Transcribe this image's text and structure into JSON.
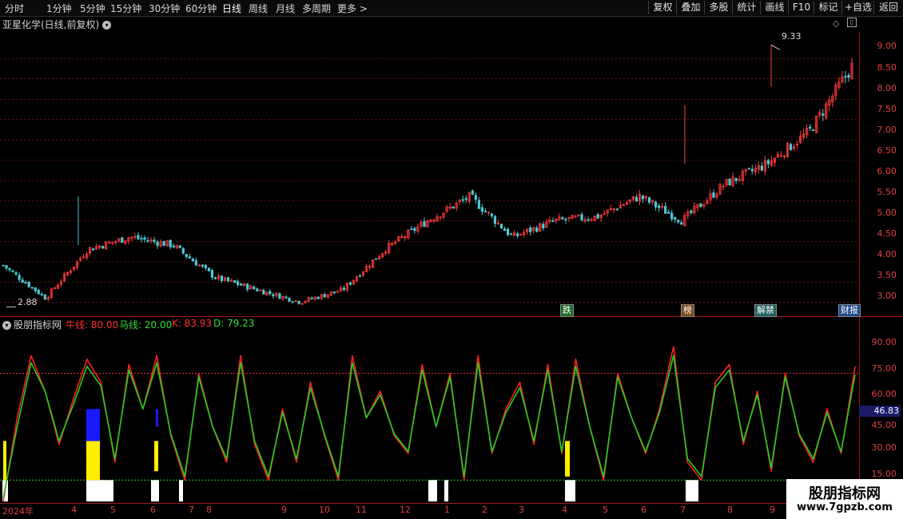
{
  "toolbar": {
    "timeframes": [
      "分时",
      "1分钟",
      "5分钟",
      "15分钟",
      "30分钟",
      "60分钟",
      "日线",
      "周线",
      "月线",
      "多周期",
      "更多 >"
    ],
    "active_timeframe": "日线",
    "buttons": [
      "复权",
      "叠加",
      "多股",
      "统计",
      "画线",
      "F10",
      "标记",
      "+自选",
      "返回"
    ]
  },
  "main_panel": {
    "title": "亚星化学(日线,前复权)",
    "high_label": "9.33",
    "low_label": "2.88",
    "event_markers": [
      {
        "label": "跌",
        "color": "#2e9a3a"
      },
      {
        "label": "榜",
        "color": "#b36a2a"
      },
      {
        "label": "解禁",
        "color": "#2e8a8a"
      },
      {
        "label": "财报",
        "color": "#2a6acc"
      }
    ]
  },
  "indicator_panel": {
    "title": "股朋指标网",
    "labels": [
      {
        "text": "牛线: 80.00",
        "color": "#ff3030"
      },
      {
        "text": "马线: 20.00",
        "color": "#30e030"
      },
      {
        "text": "K: 83.93",
        "color": "#ff3030"
      },
      {
        "text": "D: 79.23",
        "color": "#30e030"
      }
    ],
    "current_value": "46.83"
  },
  "x_axis": {
    "months": [
      "2024年",
      "4",
      "5",
      "6",
      "7",
      "8",
      "9",
      "10",
      "11",
      "12",
      "1",
      "2",
      "3",
      "4",
      "5",
      "6",
      "7",
      "8",
      "9"
    ]
  },
  "watermark": {
    "line1": "股朋指标网",
    "line2": "www.7gpzb.com"
  },
  "chart_data": [
    {
      "type": "candlestick",
      "title": "亚星化学(日线,前复权)",
      "ylim": [
        2.65,
        9.65
      ],
      "yticks": [
        "9.00",
        "8.50",
        "8.00",
        "7.50",
        "7.00",
        "6.50",
        "6.00",
        "5.50",
        "5.00",
        "4.50",
        "4.00",
        "3.50",
        "3.00"
      ],
      "x": [
        "2024-01",
        "2024-02",
        "2024-03",
        "2024-04-mid",
        "2024-05",
        "2024-06",
        "2024-07",
        "2024-08",
        "2024-09",
        "2024-10",
        "2024-11",
        "2024-12",
        "2025-01",
        "2025-02",
        "2025-03",
        "2025-04",
        "2025-05",
        "2025-06",
        "2025-07",
        "2025-08",
        "2025-09"
      ],
      "close": [
        3.9,
        3.1,
        4.3,
        4.6,
        4.4,
        3.6,
        3.3,
        3.0,
        3.3,
        4.3,
        5.0,
        5.6,
        4.6,
        5.0,
        5.1,
        5.6,
        5.0,
        5.9,
        6.4,
        7.2,
        8.8
      ],
      "annotations": {
        "high": 9.33,
        "low": 2.88
      },
      "grid": true
    },
    {
      "type": "line",
      "title": "股朋指标网",
      "ylim": [
        8,
        105
      ],
      "yticks": [
        "90.00",
        "75.00",
        "60.00",
        "45.00",
        "30.00",
        "15.00"
      ],
      "reference_lines": [
        {
          "name": "牛线",
          "value": 80.0
        },
        {
          "name": "马线",
          "value": 20.0
        }
      ],
      "series": [
        {
          "name": "K",
          "color": "#ff2020",
          "values": [
            8,
            55,
            90,
            70,
            40,
            65,
            88,
            75,
            30,
            85,
            60,
            90,
            45,
            20,
            80,
            50,
            30,
            90,
            40,
            20,
            60,
            30,
            75,
            45,
            20,
            90,
            55,
            70,
            45,
            35,
            85,
            50,
            80,
            20,
            90,
            35,
            60,
            75,
            40,
            85,
            35,
            88,
            50,
            20,
            80,
            55,
            35,
            60,
            95,
            30,
            20,
            75,
            85,
            40,
            70,
            25,
            80,
            45,
            30,
            60,
            35,
            83.93
          ]
        },
        {
          "name": "D",
          "color": "#20d020",
          "values": [
            10,
            50,
            86,
            70,
            42,
            62,
            84,
            73,
            32,
            82,
            60,
            86,
            46,
            22,
            78,
            50,
            32,
            86,
            42,
            22,
            58,
            32,
            72,
            46,
            22,
            86,
            55,
            68,
            46,
            36,
            82,
            50,
            78,
            22,
            86,
            36,
            58,
            72,
            42,
            82,
            36,
            84,
            50,
            22,
            78,
            55,
            36,
            58,
            90,
            32,
            22,
            72,
            82,
            42,
            68,
            27,
            78,
            46,
            32,
            58,
            36,
            79.23
          ]
        }
      ],
      "current_value": 46.83
    }
  ]
}
